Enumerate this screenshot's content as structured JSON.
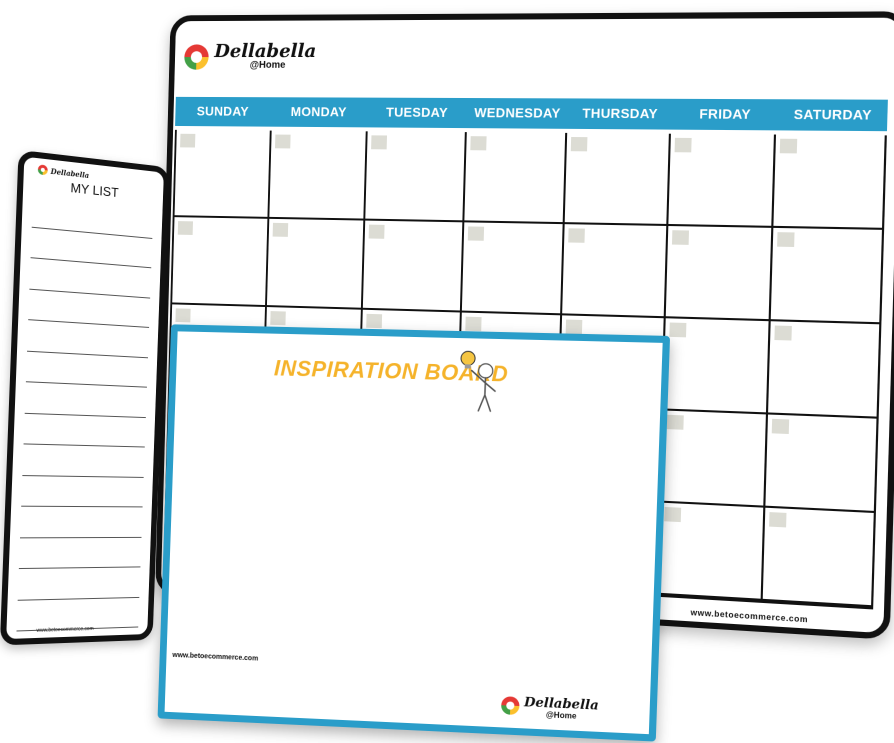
{
  "calendar": {
    "brand": {
      "name": "Dellabella",
      "sub": "@Home"
    },
    "days": [
      "SUNDAY",
      "MONDAY",
      "TUESDAY",
      "WEDNESDAY",
      "THURSDAY",
      "FRIDAY",
      "SATURDAY"
    ],
    "url": "www.betoecommerce.com",
    "band_color": "#2a9dc9"
  },
  "list": {
    "brand": "Dellabella",
    "title": "MY LIST",
    "url": "www.betoecommerce.com"
  },
  "inspiration": {
    "title": "INSPIRATION BOARD",
    "url": "www.betoecommerce.com",
    "brand": {
      "name": "Dellabella",
      "sub": "@Home"
    },
    "border_color": "#2a9dc9",
    "title_color": "#f5b32b"
  }
}
